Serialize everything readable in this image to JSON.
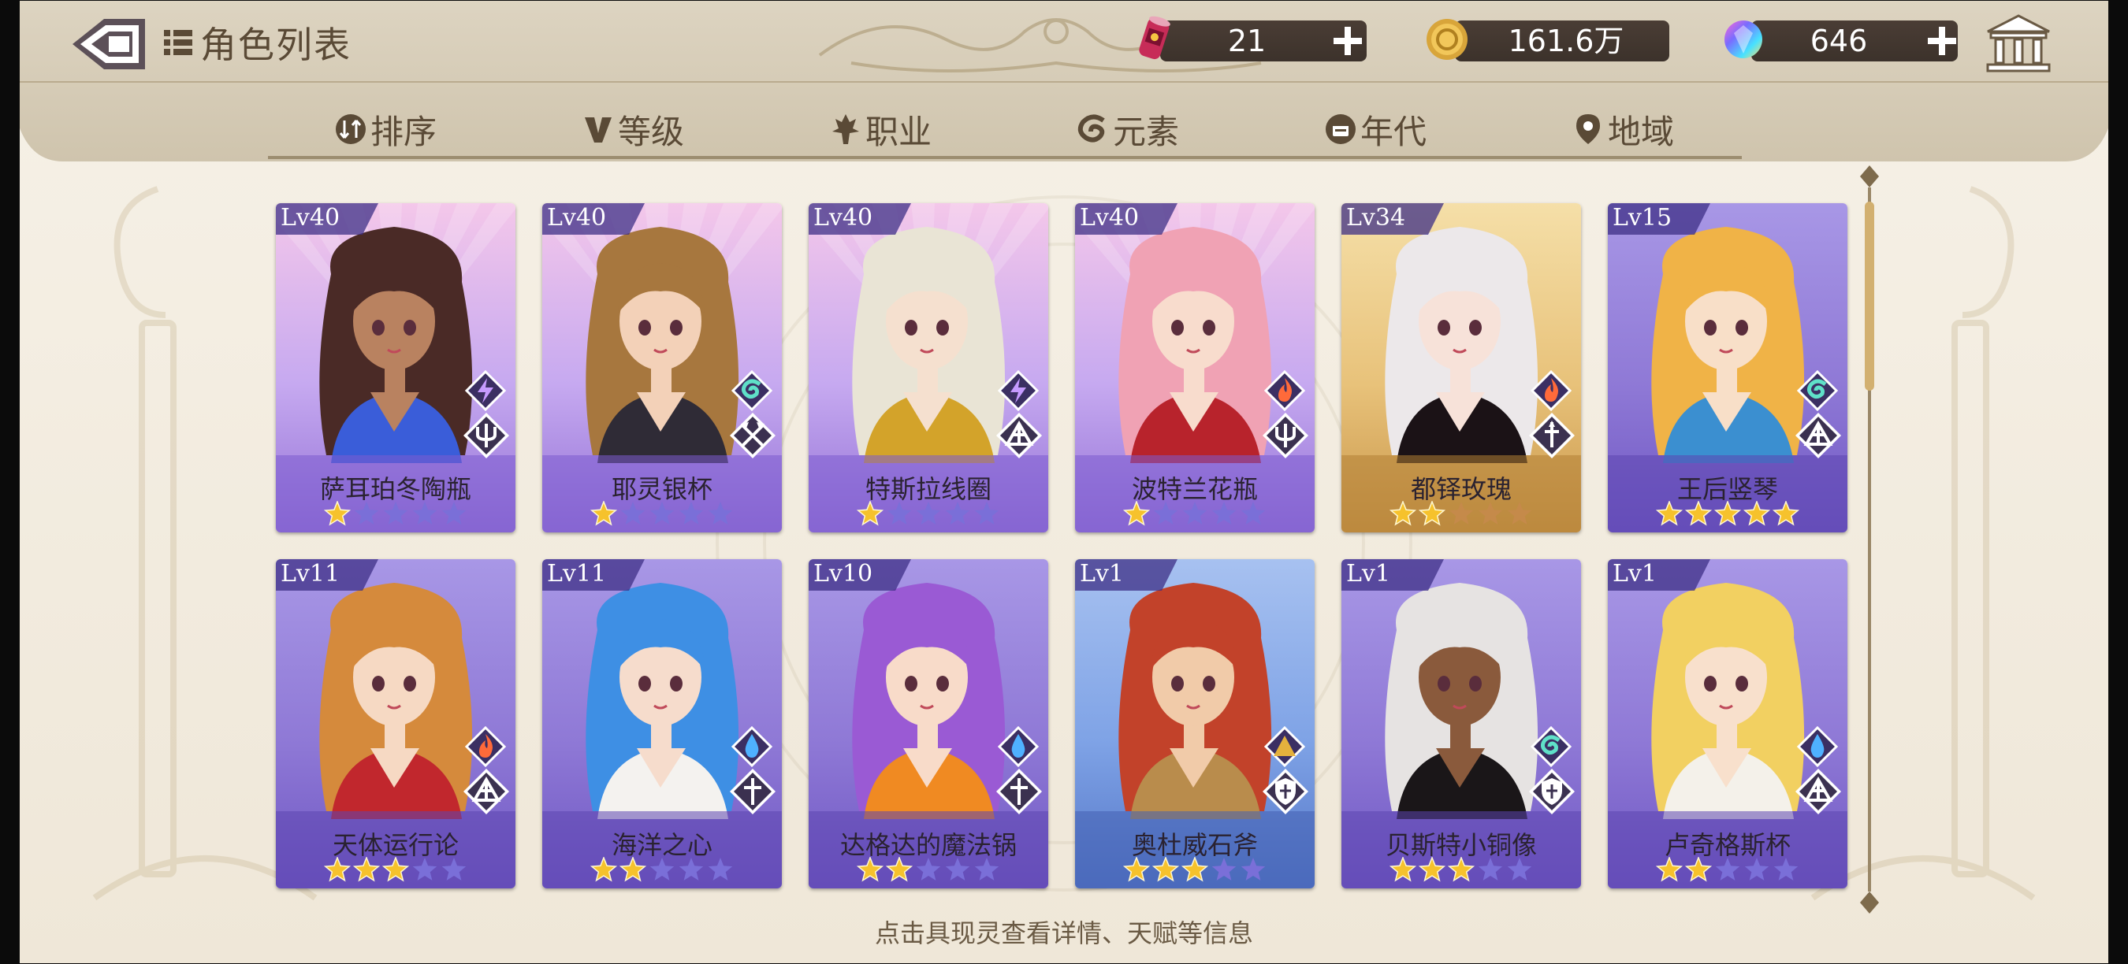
{
  "header": {
    "title": "角色列表",
    "currencies": [
      {
        "icon": "ticket-can-icon",
        "value": "21"
      },
      {
        "icon": "gold-coin-icon",
        "value": "161.6万"
      },
      {
        "icon": "rainbow-gem-icon",
        "value": "646"
      }
    ]
  },
  "filters": [
    {
      "label": "排序",
      "icon": "sort-icon"
    },
    {
      "label": "等级",
      "icon": "level-icon"
    },
    {
      "label": "职业",
      "icon": "profession-icon"
    },
    {
      "label": "元素",
      "icon": "element-icon"
    },
    {
      "label": "年代",
      "icon": "era-icon"
    },
    {
      "label": "地域",
      "icon": "location-pin-icon"
    }
  ],
  "cards": [
    {
      "lv": "Lv40",
      "name": "萨耳珀冬陶瓶",
      "stars": 1,
      "element": "lightning",
      "cls": "trident",
      "theme": "purple-burst",
      "hair": "#4a2a26",
      "skin": "#b98260",
      "accent": "#3a5dd9"
    },
    {
      "lv": "Lv40",
      "name": "耶灵银杯",
      "stars": 1,
      "element": "wind",
      "cls": "axes",
      "theme": "purple-burst",
      "hair": "#a7773e",
      "skin": "#f3d1b8",
      "accent": "#2f2b36"
    },
    {
      "lv": "Lv40",
      "name": "特斯拉线圈",
      "stars": 1,
      "element": "lightning",
      "cls": "prism",
      "theme": "purple-burst",
      "hair": "#e9e4d5",
      "skin": "#f5e0cf",
      "accent": "#d3a32a"
    },
    {
      "lv": "Lv40",
      "name": "波特兰花瓶",
      "stars": 1,
      "element": "fire",
      "cls": "trident",
      "theme": "purple-burst",
      "hair": "#f0a2b4",
      "skin": "#f8dccd",
      "accent": "#b8232c"
    },
    {
      "lv": "Lv34",
      "name": "都铎玫瑰",
      "stars": 2,
      "element": "fire",
      "cls": "sword",
      "theme": "gold",
      "hair": "#ece8ea",
      "skin": "#f7e2d9",
      "accent": "#1b1216"
    },
    {
      "lv": "Lv15",
      "name": "王后竖琴",
      "stars": 5,
      "element": "wind",
      "cls": "prism",
      "theme": "purple",
      "hair": "#f0b347",
      "skin": "#f8dfc8",
      "accent": "#3b8fd0"
    },
    {
      "lv": "Lv11",
      "name": "天体运行论",
      "stars": 3,
      "element": "fire",
      "cls": "prism",
      "theme": "purple",
      "hair": "#d58a3c",
      "skin": "#f6d9c3",
      "accent": "#c1272d"
    },
    {
      "lv": "Lv11",
      "name": "海洋之心",
      "stars": 2,
      "element": "water",
      "cls": "cross",
      "theme": "purple",
      "hair": "#3e8fe4",
      "skin": "#f6dccc",
      "accent": "#f4f2ef"
    },
    {
      "lv": "Lv10",
      "name": "达格达的魔法锅",
      "stars": 2,
      "element": "water",
      "cls": "cross",
      "theme": "purple",
      "hair": "#9a5ad4",
      "skin": "#f8dbc9",
      "accent": "#f08a22"
    },
    {
      "lv": "Lv1",
      "name": "奥杜威石斧",
      "stars": 3,
      "element": "earth",
      "cls": "shield",
      "theme": "blue",
      "hair": "#c2422a",
      "skin": "#f1cba9",
      "accent": "#b98c4c"
    },
    {
      "lv": "Lv1",
      "name": "贝斯特小铜像",
      "stars": 3,
      "element": "wind",
      "cls": "shield",
      "theme": "purple",
      "hair": "#e6e3e2",
      "skin": "#8a5a3c",
      "accent": "#1a1618"
    },
    {
      "lv": "Lv1",
      "name": "卢奇格斯杯",
      "stars": 2,
      "element": "water",
      "cls": "prism",
      "theme": "purple",
      "hair": "#f2d061",
      "skin": "#f8e0cc",
      "accent": "#f4f1ea"
    }
  ],
  "hint": "点击具现灵查看详情、天赋等信息",
  "colors": {
    "panel": "#f3ece0",
    "frame": "#d8ccb3",
    "text": "#5a4a36",
    "star_gold": "#f6c22c",
    "star_empty": "#7a6fd8"
  }
}
